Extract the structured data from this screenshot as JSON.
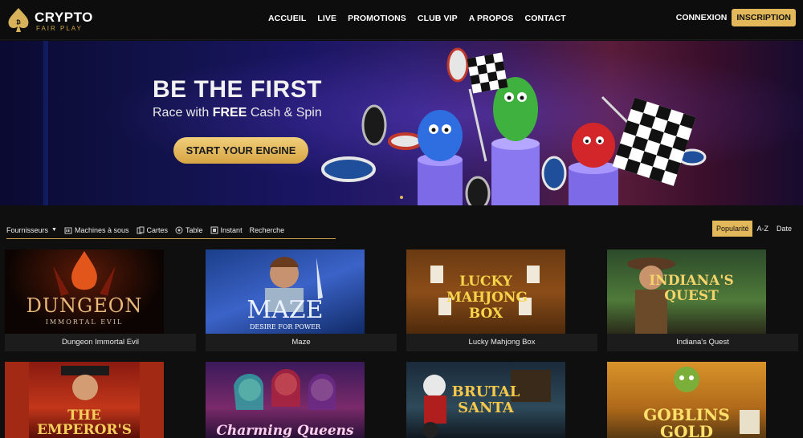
{
  "brand": {
    "title": "CRYPTO",
    "subtitle": "FAIR PLAY"
  },
  "nav": [
    "ACCUEIL",
    "LIVE",
    "PROMOTIONS",
    "CLUB VIP",
    "A PROPOS",
    "CONTACT"
  ],
  "auth": {
    "login": "CONNEXION",
    "signup": "INSCRIPTION"
  },
  "hero": {
    "title": "BE THE FIRST",
    "sub_prefix": "Race with ",
    "sub_bold": "FREE",
    "sub_suffix": " Cash & Spin",
    "cta": "START YOUR ENGINE"
  },
  "filters": {
    "providers": "Fournisseurs",
    "slots": "Machines à sous",
    "cards": "Cartes",
    "table": "Table",
    "instant": "Instant",
    "search": "Recherche"
  },
  "sort": {
    "popular": "Popularité",
    "az": "A-Z",
    "date": "Date"
  },
  "games": [
    {
      "name": "Dungeon Immortal Evil",
      "art_title": "DUNGEON",
      "art_sub": "IMMORTAL  EVIL"
    },
    {
      "name": "Maze",
      "art_title": "MAZE",
      "art_sub": "DESIRE FOR POWER"
    },
    {
      "name": "Lucky Mahjong Box",
      "art_title": "LUCKY MAHJONG BOX",
      "art_sub": ""
    },
    {
      "name": "Indiana's Quest",
      "art_title": "INDIANA'S QUEST",
      "art_sub": ""
    },
    {
      "name": "",
      "art_title": "THE EMPEROR'S TOMB",
      "art_sub": ""
    },
    {
      "name": "",
      "art_title": "Charming Queens",
      "art_sub": ""
    },
    {
      "name": "",
      "art_title": "BRUTAL SANTA",
      "art_sub": ""
    },
    {
      "name": "",
      "art_title": "GOBLINS GOLD",
      "art_sub": ""
    }
  ]
}
